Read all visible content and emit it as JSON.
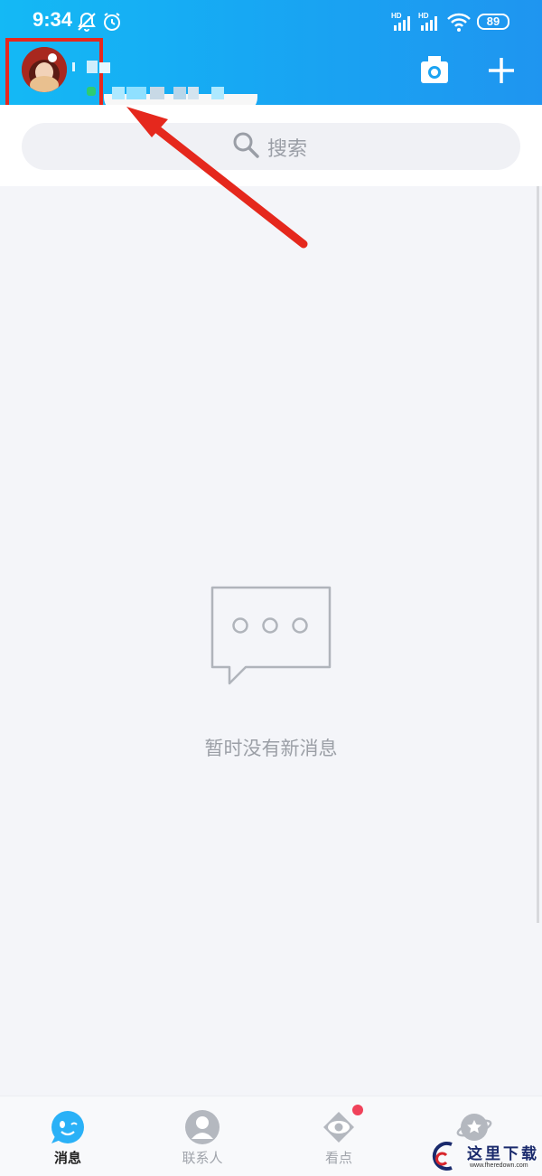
{
  "status_bar": {
    "time": "9:34",
    "battery": "89",
    "signal_label_1": "HD",
    "signal_label_2": "HD"
  },
  "header": {
    "camera_icon": "camera-icon",
    "plus_icon": "plus-icon"
  },
  "search": {
    "label": "搜索"
  },
  "empty_state": {
    "message": "暂时没有新消息"
  },
  "tabs": [
    {
      "label": "消息",
      "active": true
    },
    {
      "label": "联系人",
      "active": false
    },
    {
      "label": "看点",
      "active": false,
      "badge": true
    },
    {
      "label": "",
      "active": false
    }
  ],
  "watermark": {
    "text": "这里下载",
    "url": "www.fheredown.com"
  },
  "colors": {
    "header_start": "#14b9f5",
    "header_end": "#1f95f0",
    "highlight": "#e5281d",
    "badge": "#f0425a"
  }
}
